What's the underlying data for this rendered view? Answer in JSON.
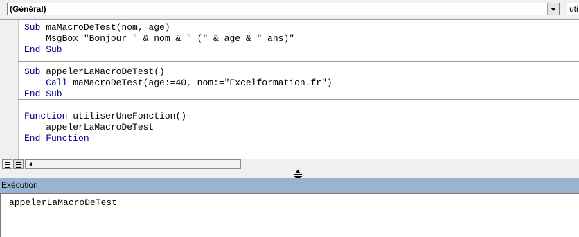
{
  "procedure_combo": {
    "value": "(Général)"
  },
  "proc_list_combo": {
    "value": "uti"
  },
  "code_lines": [
    {
      "kw": "Sub",
      "text": " maMacroDeTest(nom, age)"
    },
    {
      "kw": "",
      "text": "    MsgBox \"Bonjour \" & nom & \" (\" & age & \" ans)\""
    },
    {
      "kw": "End Sub",
      "text": ""
    },
    {
      "kw": "Sub",
      "text": " appelerLaMacroDeTest()"
    },
    {
      "kw": "    Call",
      "text": " maMacroDeTest(age:=40, nom:=\"Excelformation.fr\")"
    },
    {
      "kw": "End Sub",
      "text": ""
    },
    {
      "kw": "Function",
      "text": " utiliserUneFonction()"
    },
    {
      "kw": "",
      "text": "    appelerLaMacroDeTest"
    },
    {
      "kw": "End Function",
      "text": ""
    }
  ],
  "immediate_window": {
    "title": "Exécution",
    "content": "appelerLaMacroDeTest"
  }
}
